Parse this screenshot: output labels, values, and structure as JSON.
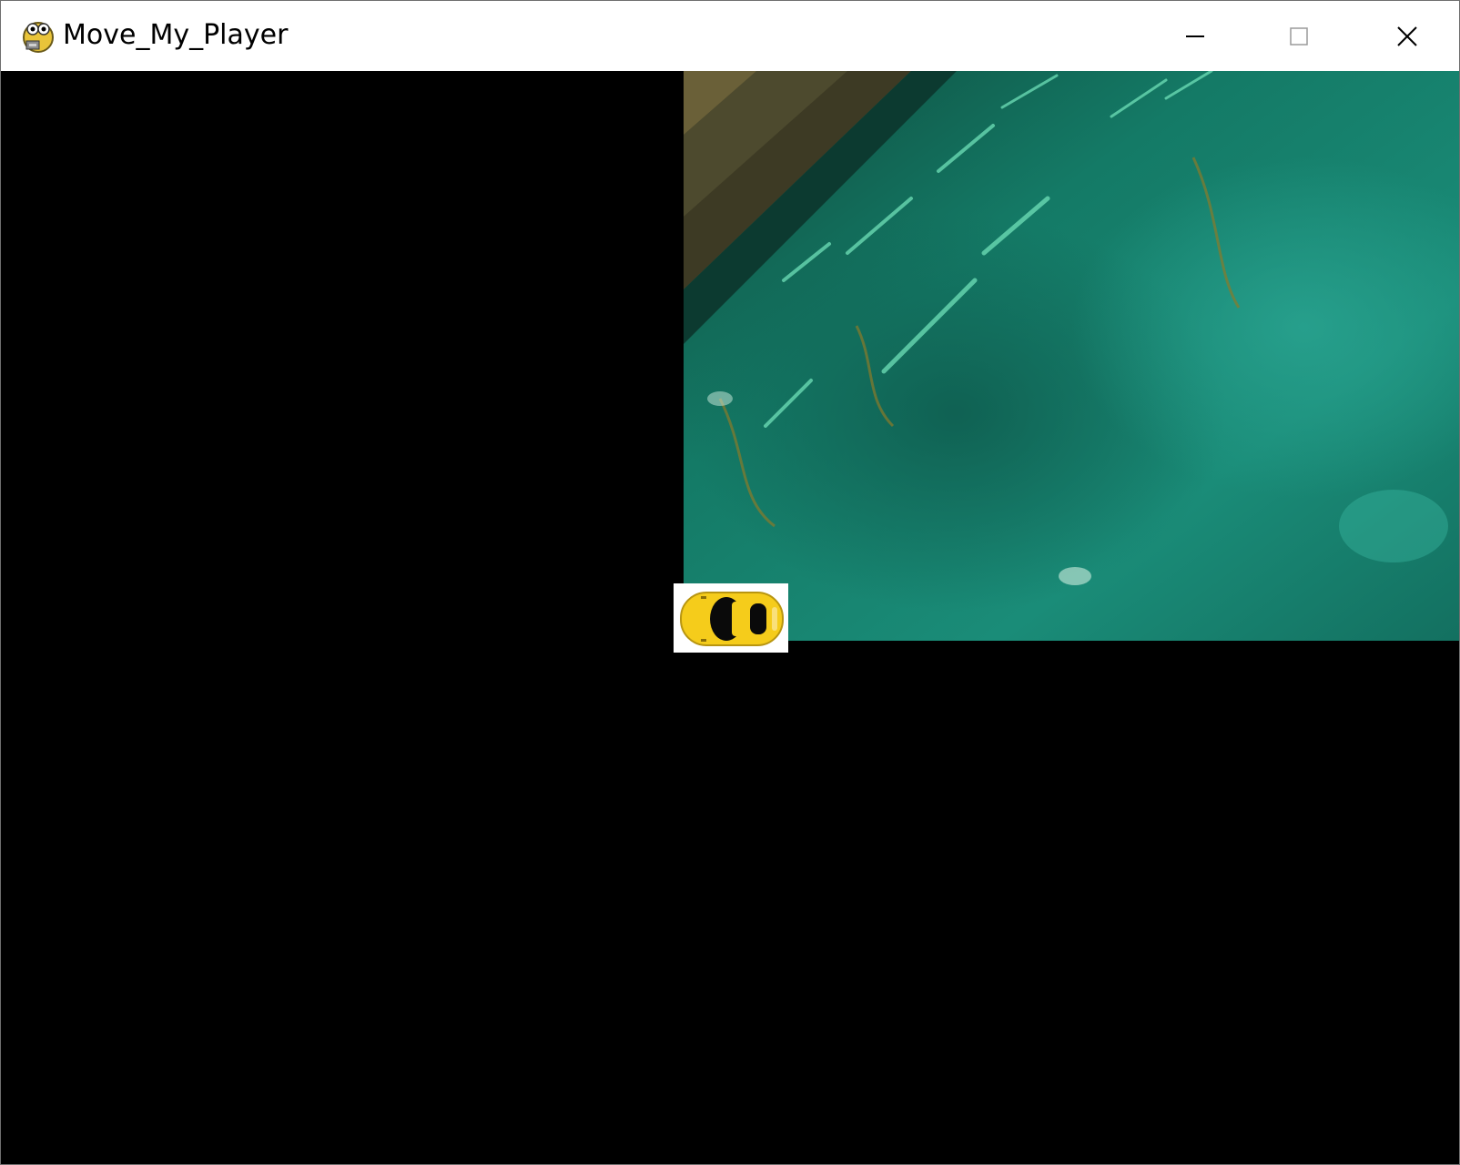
{
  "window": {
    "title": "Move_My_Player",
    "controls": {
      "minimize": "minimize-icon",
      "maximize": "maximize-icon",
      "close": "close-icon"
    }
  },
  "game": {
    "background_color": "#000000",
    "background_image": "teal-water-scene",
    "player": {
      "sprite": "yellow-car-icon",
      "color": "#f5cc1b"
    }
  }
}
